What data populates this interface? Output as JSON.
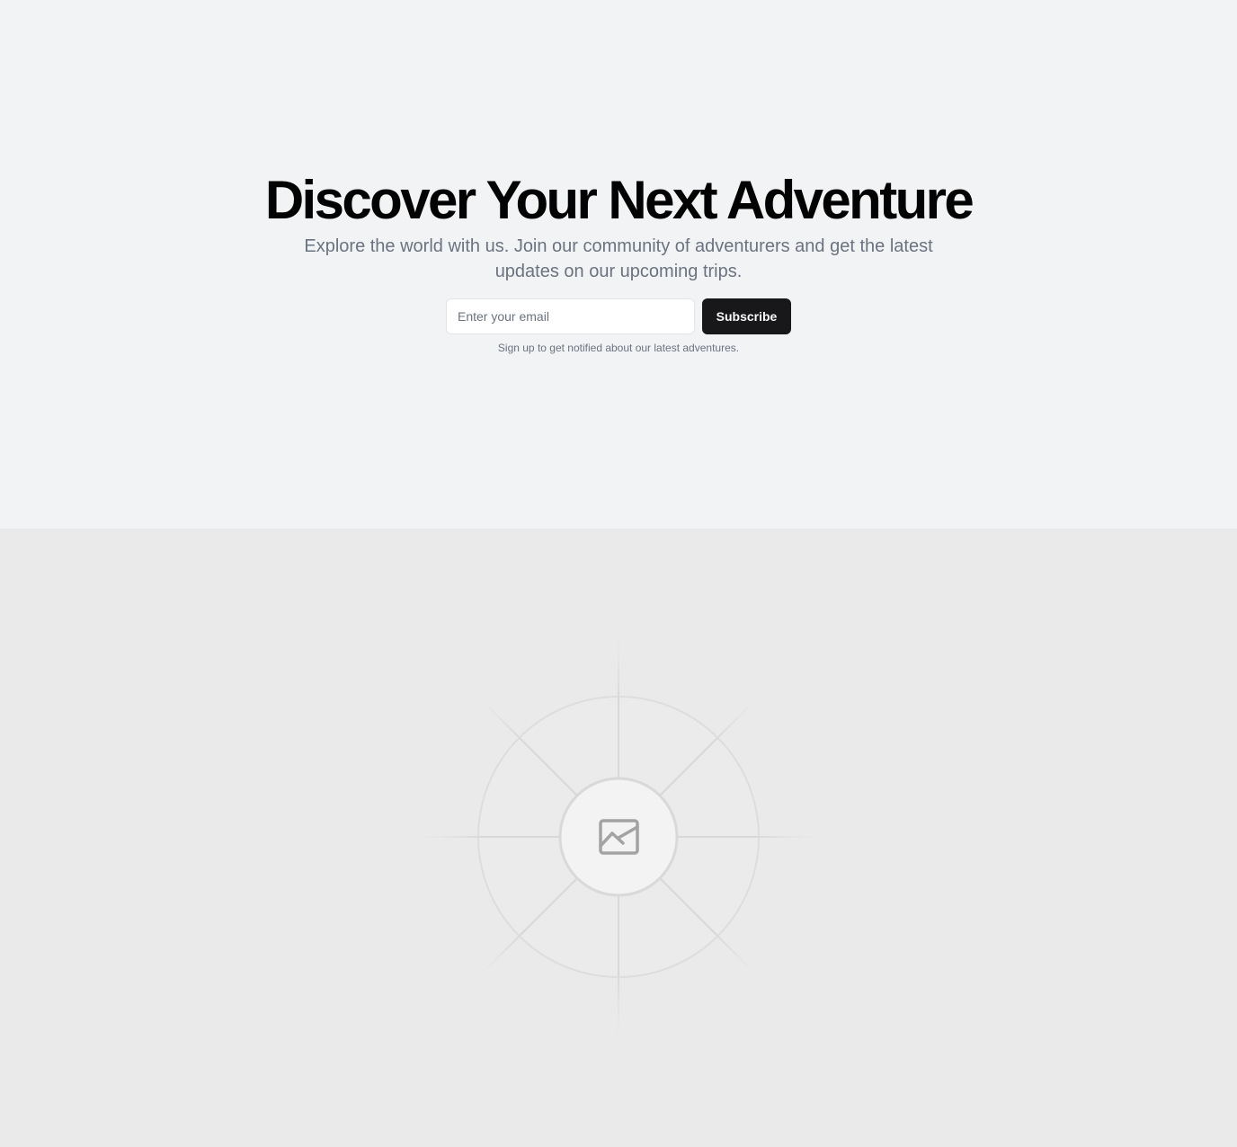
{
  "hero": {
    "title": "Discover Your Next Adventure",
    "subtitle": "Explore the world with us. Join our community of adventurers and get the latest updates on our upcoming trips.",
    "email_placeholder": "Enter your email",
    "subscribe_label": "Subscribe",
    "note": "Sign up to get notified about our latest adventures."
  },
  "media": {
    "icon": "image-placeholder-icon"
  },
  "colors": {
    "hero_background": "#f2f3f4",
    "media_background": "#eaeaea",
    "button_background": "#18181b",
    "muted_text": "#6b7280"
  }
}
